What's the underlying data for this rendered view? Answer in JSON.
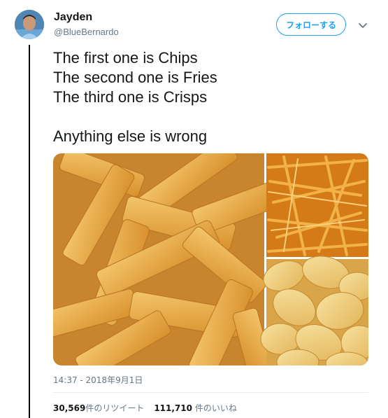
{
  "user": {
    "display_name": "Jayden",
    "handle": "@BlueBernardo",
    "avatar_icon": "avatar"
  },
  "follow_button_label": "フォローする",
  "menu_icon": "chevron-down-icon",
  "tweet": {
    "lines": [
      "The first one is Chips",
      "The second one is Fries",
      "The third one is Crisps",
      "Anything else is wrong"
    ]
  },
  "media": {
    "images": [
      "chips-photo",
      "fries-photo",
      "crisps-photo"
    ]
  },
  "timestamp": "14:37 - 2018年9月1日",
  "stats": {
    "retweets_count": "30,569",
    "retweets_label": "件のリツイート",
    "likes_count": "111,710",
    "likes_label": "件のいいね"
  },
  "colors": {
    "accent": "#1da1f2",
    "thread_line": "#0a0a0a",
    "secondary_text": "#657786"
  }
}
